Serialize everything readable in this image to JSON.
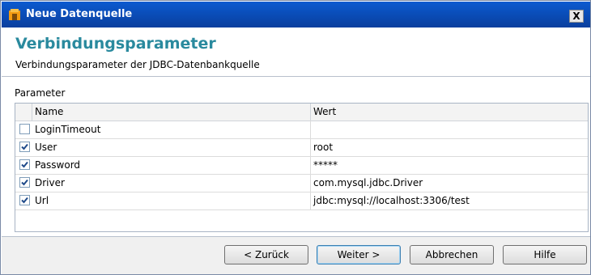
{
  "window": {
    "title": "Neue Datenquelle",
    "close_label": "X"
  },
  "header": {
    "title": "Verbindungsparameter",
    "subtitle": "Verbindungsparameter der JDBC-Datenbankquelle"
  },
  "section_label": "Parameter",
  "table": {
    "columns": [
      "Name",
      "Wert"
    ],
    "rows": [
      {
        "checked": false,
        "name": "LoginTimeout",
        "value": ""
      },
      {
        "checked": true,
        "name": "User",
        "value": "root"
      },
      {
        "checked": true,
        "name": "Password",
        "value": "*****"
      },
      {
        "checked": true,
        "name": "Driver",
        "value": "com.mysql.jdbc.Driver"
      },
      {
        "checked": true,
        "name": "Url",
        "value": "jdbc:mysql://localhost:3306/test"
      }
    ]
  },
  "buttons": {
    "back": "< Zurück",
    "next": "Weiter >",
    "cancel": "Abbrechen",
    "help": "Hilfe"
  },
  "colors": {
    "titlebar": "#0b5ad0",
    "accent_title": "#2a8a9e"
  }
}
